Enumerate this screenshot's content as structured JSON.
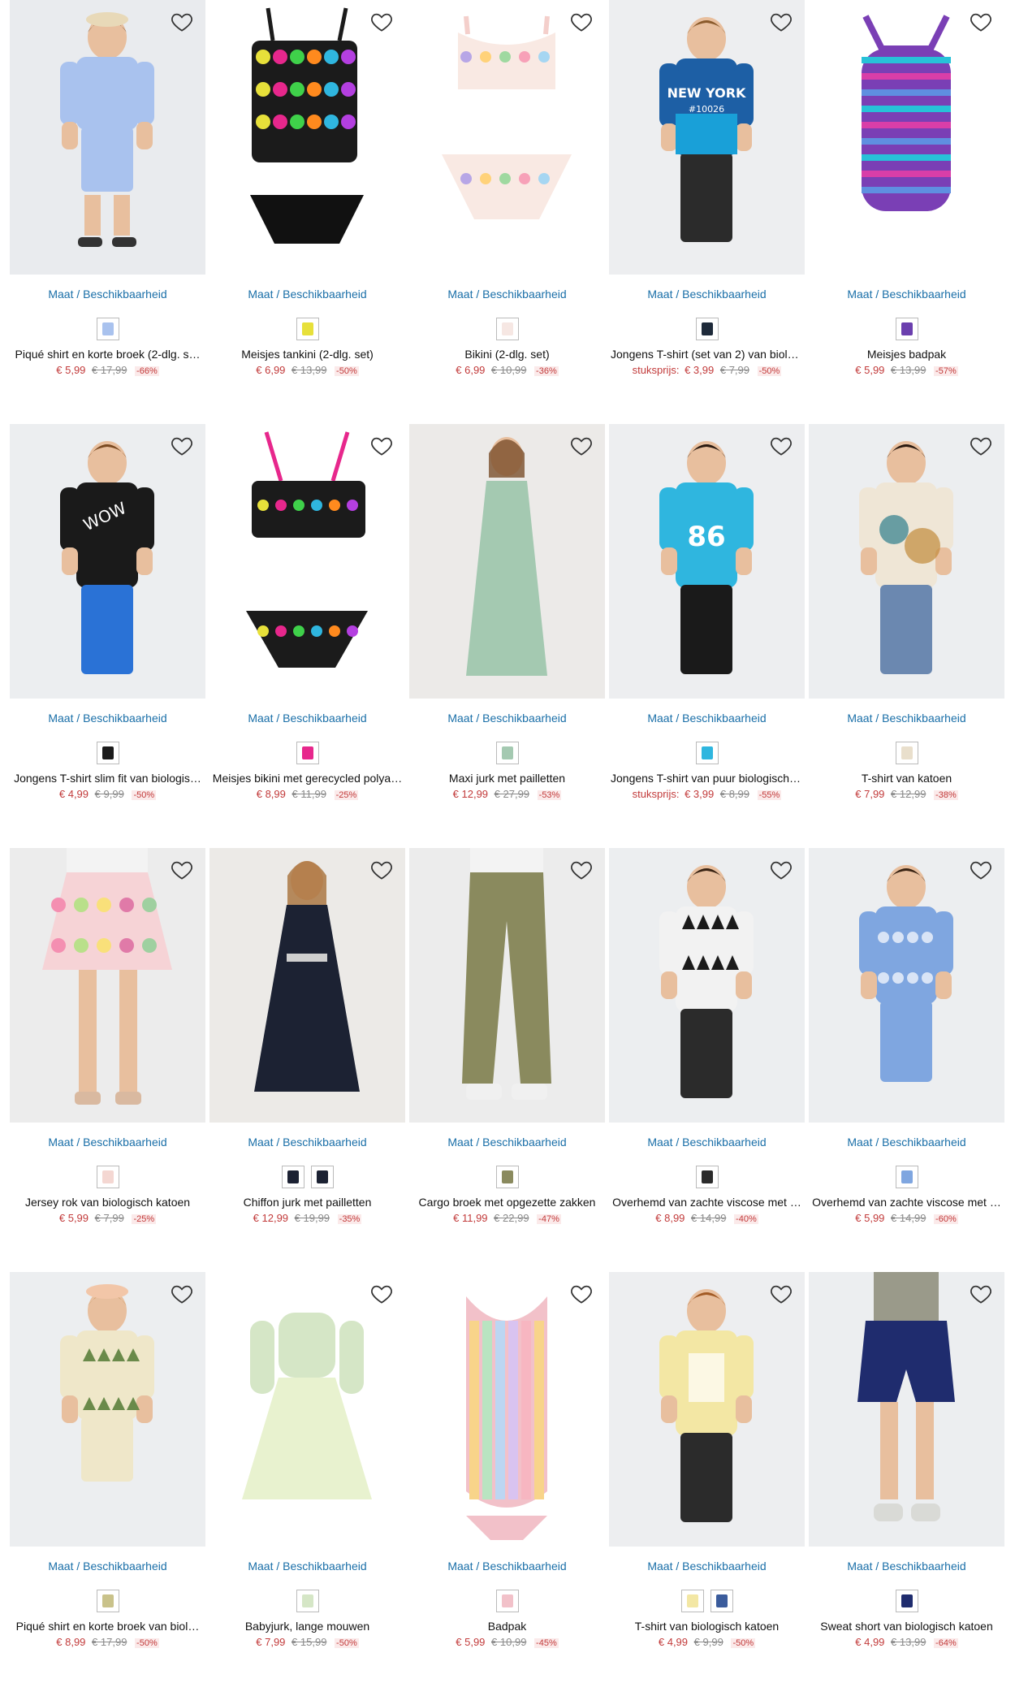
{
  "common": {
    "size_link": "Maat / Beschikbaarheid"
  },
  "products": [
    {
      "name": "Piqué shirt en korte broek (2-dlg. s…",
      "price": "€ 5,99",
      "was": "€ 17,99",
      "discount": "-66%",
      "swatches": [
        "#a9c2ee"
      ],
      "bg": "#e9ebee",
      "art": "kid-blue"
    },
    {
      "name": "Meisjes tankini (2-dlg. set)",
      "price": "€ 6,99",
      "was": "€ 13,99",
      "discount": "-50%",
      "swatches": [
        "#e7e03a"
      ],
      "bg": "#ffffff",
      "art": "swim-butterfly"
    },
    {
      "name": "Bikini (2-dlg. set)",
      "price": "€ 6,99",
      "was": "€ 10,99",
      "discount": "-36%",
      "swatches": [
        "#f6e7e3"
      ],
      "bg": "#ffffff",
      "art": "swim-pastel"
    },
    {
      "name": "Jongens T-shirt (set van 2) van biolo…",
      "price": "€ 3,99",
      "was": "€ 7,99",
      "discount": "-50%",
      "prefix": "stuksprijs:",
      "swatches": [
        "#1e2a3a"
      ],
      "bg": "#edeef0",
      "art": "boy-ny"
    },
    {
      "name": "Meisjes badpak",
      "price": "€ 5,99",
      "was": "€ 13,99",
      "discount": "-57%",
      "swatches": [
        "#6b3fae"
      ],
      "bg": "#ffffff",
      "art": "swim-purple"
    },
    {
      "name": "Jongens T-shirt slim fit van biologis…",
      "price": "€ 4,99",
      "was": "€ 9,99",
      "discount": "-50%",
      "swatches": [
        "#1b1b1b"
      ],
      "bg": "#eceef0",
      "art": "boy-black"
    },
    {
      "name": "Meisjes bikini met gerecycled polya…",
      "price": "€ 8,99",
      "was": "€ 11,99",
      "discount": "-25%",
      "swatches": [
        "#e7278c"
      ],
      "bg": "#ffffff",
      "art": "swim-stars"
    },
    {
      "name": "Maxi jurk met pailletten",
      "price": "€ 12,99",
      "was": "€ 27,99",
      "discount": "-53%",
      "swatches": [
        "#a4c9b1"
      ],
      "bg": "#eceae8",
      "art": "girl-mint"
    },
    {
      "name": "Jongens T-shirt van puur biologisch …",
      "price": "€ 3,99",
      "was": "€ 8,99",
      "discount": "-55%",
      "prefix": "stuksprijs:",
      "swatches": [
        "#2fb6df"
      ],
      "bg": "#edeef0",
      "art": "boy-cyan"
    },
    {
      "name": "T-shirt van katoen",
      "price": "€ 7,99",
      "was": "€ 12,99",
      "discount": "-38%",
      "swatches": [
        "#e9dfcc"
      ],
      "bg": "#eceef0",
      "art": "boy-tiedye"
    },
    {
      "name": "Jersey rok van biologisch katoen",
      "price": "€ 5,99",
      "was": "€ 7,99",
      "discount": "-25%",
      "swatches": [
        "#f4d7d2"
      ],
      "bg": "#ececec",
      "art": "skirt"
    },
    {
      "name": "Chiffon jurk met pailletten",
      "price": "€ 12,99",
      "was": "€ 19,99",
      "discount": "-35%",
      "swatches": [
        "#1c2233",
        "#1c2233"
      ],
      "bg": "#eceae7",
      "art": "girl-navy"
    },
    {
      "name": "Cargo broek met opgezette zakken",
      "price": "€ 11,99",
      "was": "€ 22,99",
      "discount": "-47%",
      "swatches": [
        "#8a8a5e"
      ],
      "bg": "#ececec",
      "art": "cargo"
    },
    {
      "name": "Overhemd van zachte viscose met …",
      "price": "€ 8,99",
      "was": "€ 14,99",
      "discount": "-40%",
      "swatches": [
        "#2b2b2b"
      ],
      "bg": "#eceef0",
      "art": "boy-palm"
    },
    {
      "name": "Overhemd van zachte viscose met …",
      "price": "€ 5,99",
      "was": "€ 14,99",
      "discount": "-60%",
      "swatches": [
        "#7fa6e0"
      ],
      "bg": "#eceef0",
      "art": "boy-hawaii"
    },
    {
      "name": "Piqué shirt en korte broek van biol…",
      "price": "€ 8,99",
      "was": "€ 17,99",
      "discount": "-50%",
      "swatches": [
        "#c9c28a"
      ],
      "bg": "#eceef0",
      "art": "boy-palmset"
    },
    {
      "name": "Babyjurk, lange mouwen",
      "price": "€ 7,99",
      "was": "€ 15,99",
      "discount": "-50%",
      "swatches": [
        "#d5e6c6"
      ],
      "bg": "#ffffff",
      "art": "baby-dress"
    },
    {
      "name": "Badpak",
      "price": "€ 5,99",
      "was": "€ 10,99",
      "discount": "-45%",
      "swatches": [
        "#f2c1c9"
      ],
      "bg": "#ffffff",
      "art": "swim-rainbow"
    },
    {
      "name": "T-shirt van biologisch katoen",
      "price": "€ 4,99",
      "was": "€ 9,99",
      "discount": "-50%",
      "swatches": [
        "#f3e7a4",
        "#3b5c9c"
      ],
      "bg": "#edeef0",
      "art": "boy-yellow"
    },
    {
      "name": "Sweat short van biologisch katoen",
      "price": "€ 4,99",
      "was": "€ 13,99",
      "discount": "-64%",
      "swatches": [
        "#1f2c6e"
      ],
      "bg": "#eceef0",
      "art": "shorts-navy"
    }
  ],
  "icons": {
    "favorite": "heart-outline-icon"
  }
}
